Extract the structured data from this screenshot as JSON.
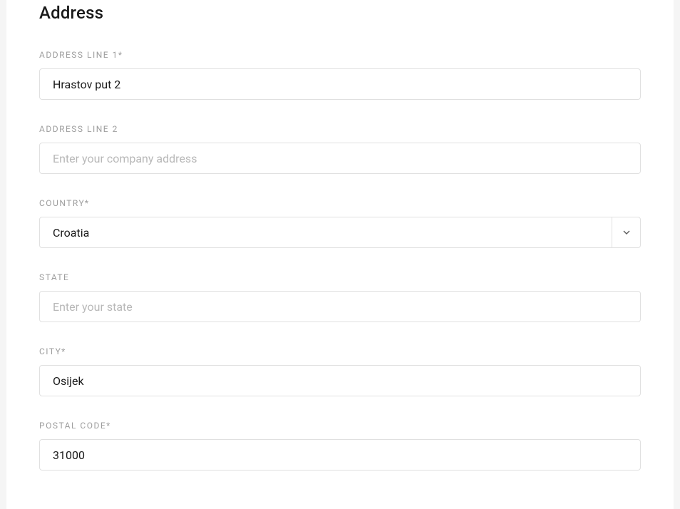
{
  "section": {
    "title": "Address"
  },
  "fields": {
    "address_line_1": {
      "label": "ADDRESS LINE 1*",
      "value": "Hrastov put 2",
      "placeholder": ""
    },
    "address_line_2": {
      "label": "ADDRESS LINE 2",
      "value": "",
      "placeholder": "Enter your company address"
    },
    "country": {
      "label": "COUNTRY*",
      "value": "Croatia"
    },
    "state": {
      "label": "STATE",
      "value": "",
      "placeholder": "Enter your state"
    },
    "city": {
      "label": "CITY*",
      "value": "Osijek",
      "placeholder": ""
    },
    "postal_code": {
      "label": "POSTAL CODE*",
      "value": "31000",
      "placeholder": ""
    }
  }
}
